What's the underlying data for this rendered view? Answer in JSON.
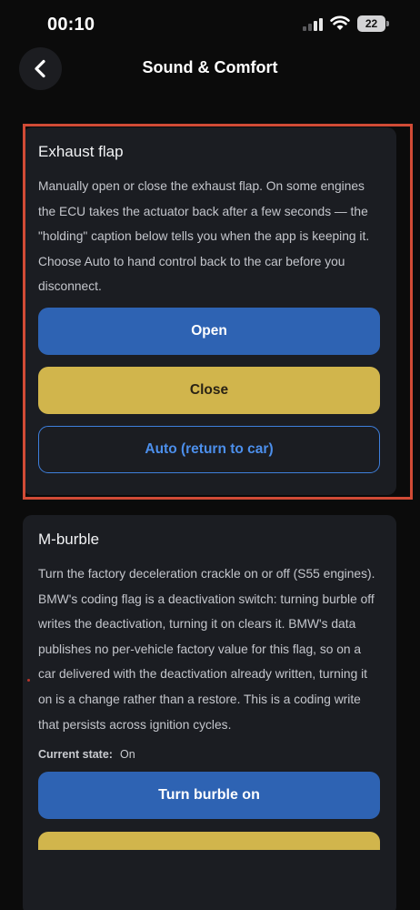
{
  "status": {
    "time": "00:10",
    "battery": "22"
  },
  "header": {
    "title": "Sound & Comfort"
  },
  "exhaust": {
    "title": "Exhaust flap",
    "description": "Manually open or close the exhaust flap. On some engines the ECU takes the actuator back after a few seconds — the \"holding\" caption below tells you when the app is keeping it. Choose Auto to hand control back to the car before you disconnect.",
    "open_label": "Open",
    "close_label": "Close",
    "auto_label": "Auto (return to car)"
  },
  "burble": {
    "title": "M-burble",
    "description": "Turn the factory deceleration crackle on or off (S55 engines). BMW's coding flag is a deactivation switch: turning burble off writes the deactivation, turning it on clears it. BMW's data publishes no per-vehicle factory value for this flag, so on a car delivered with the deactivation already written, turning it on is a change rather than a restore. This is a coding write that persists across ignition cycles.",
    "state_label": "Current state:",
    "state_value": "On",
    "turn_on_label": "Turn burble on"
  },
  "colors": {
    "accent_blue": "#2e63b3",
    "accent_yellow": "#d1b54c",
    "outline_blue": "#3e7fdc",
    "highlight": "#d14b36"
  }
}
